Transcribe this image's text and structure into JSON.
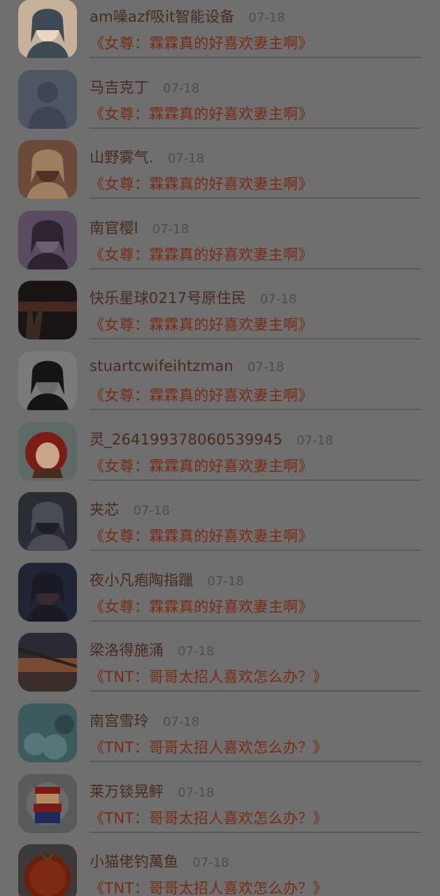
{
  "comments": [
    {
      "name": "am噪azf吸it智能设备",
      "date": "07-18",
      "book": "《女尊：霖霖真的好喜欢妻主啊》",
      "avatar": "avatar-girl-sunglasses",
      "colors": [
        "#c8b19a",
        "#3d4a55",
        "#e8d6c2"
      ]
    },
    {
      "name": "马吉克丁",
      "date": "07-18",
      "book": "《女尊：霖霖真的好喜欢妻主啊》",
      "avatar": "avatar-default-silhouette",
      "colors": [
        "#4e5563",
        "#3f4653",
        "#4e5563"
      ]
    },
    {
      "name": "山野雾气.",
      "date": "07-18",
      "book": "《女尊：霖霖真的好喜欢妻主啊》",
      "avatar": "avatar-girl-blonde",
      "colors": [
        "#6b4a3a",
        "#a07e60",
        "#503328"
      ]
    },
    {
      "name": "南官樱l",
      "date": "07-18",
      "book": "《女尊：霖霖真的好喜欢妻主啊》",
      "avatar": "avatar-girl-bear-hat",
      "colors": [
        "#5a4b60",
        "#2d2430",
        "#6a6070"
      ]
    },
    {
      "name": "快乐星球0217号原住民",
      "date": "07-18",
      "book": "《女尊：霖霖真的好喜欢妻主啊》",
      "avatar": "avatar-peace-sign-night",
      "colors": [
        "#1b1414",
        "#5a3020",
        "#302020"
      ]
    },
    {
      "name": "stuartcwifeihtzman",
      "date": "07-18",
      "book": "《女尊：霖霖真的好喜欢妻主啊》",
      "avatar": "avatar-girl-caption",
      "colors": [
        "#7a7a7a",
        "#141414",
        "#6a6a6a"
      ]
    },
    {
      "name": "灵_264199378060539945",
      "date": "07-18",
      "book": "《女尊：霖霖真的好喜欢妻主啊》",
      "avatar": "avatar-cartoon-redhair",
      "colors": [
        "#5e6a66",
        "#7a1d14",
        "#4b2a20"
      ]
    },
    {
      "name": "夹芯",
      "date": "07-18",
      "book": "《女尊：霖霖真的好喜欢妻主啊》",
      "avatar": "avatar-street-dusk",
      "colors": [
        "#2a2d33",
        "#4a4c55",
        "#1e2025"
      ]
    },
    {
      "name": "夜小凡疱陶指躐",
      "date": "07-18",
      "book": "《女尊：霖霖真的好喜欢妻主啊》",
      "avatar": "avatar-couple-dark",
      "colors": [
        "#1f2535",
        "#1a1a24",
        "#3a2a30"
      ]
    },
    {
      "name": "梁洛得施涌",
      "date": "07-18",
      "book": "《TNT：哥哥太招人喜欢怎么办？》",
      "avatar": "avatar-sunset-pier",
      "colors": [
        "#3b2e2a",
        "#7a4a30",
        "#2a2a35"
      ]
    },
    {
      "name": "南宫雪玲",
      "date": "07-18",
      "book": "《TNT：哥哥太招人喜欢怎么办？》",
      "avatar": "avatar-blue-flowers",
      "colors": [
        "#3d5a5e",
        "#56767a",
        "#2e4448"
      ]
    },
    {
      "name": "莱万锬晃鲆",
      "date": "07-18",
      "book": "《TNT：哥哥太招人喜欢怎么办？》",
      "avatar": "avatar-mario-pixel",
      "colors": [
        "#5a5a5a",
        "#7a1a14",
        "#1c2a5a"
      ]
    },
    {
      "name": "小猫佬钓萬鱼",
      "date": "07-18",
      "book": "《TNT：哥哥太招人喜欢怎么办？》",
      "avatar": "avatar-tomato",
      "colors": [
        "#6a2010",
        "#8a3018",
        "#3a5020"
      ]
    }
  ]
}
